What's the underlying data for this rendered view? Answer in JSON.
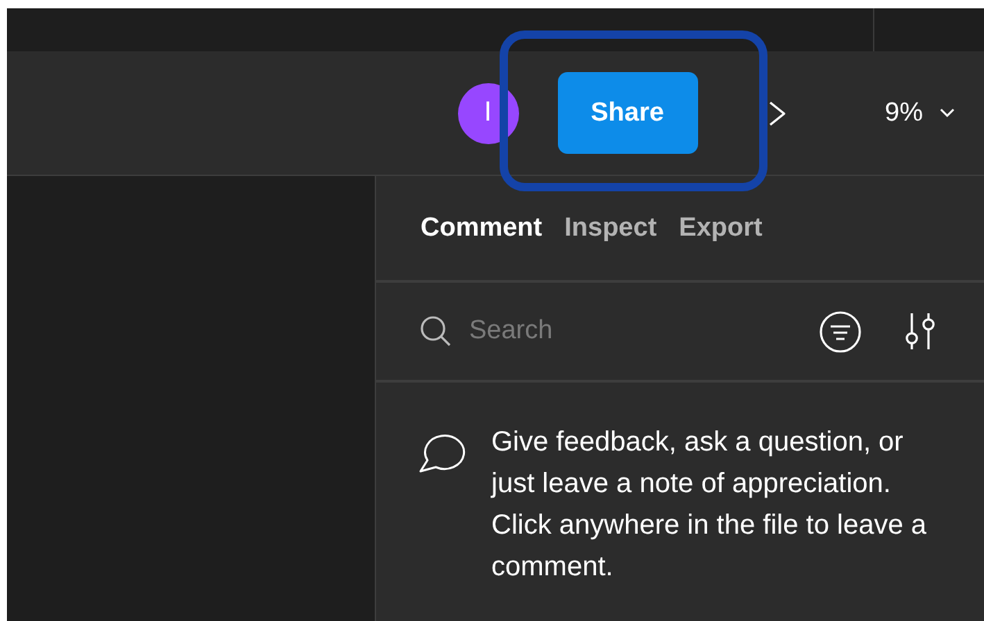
{
  "toolbar": {
    "avatar": {
      "initial": "I"
    },
    "share_button": {
      "label": "Share"
    },
    "zoom": {
      "value": "9%"
    }
  },
  "panel": {
    "tabs": [
      {
        "label": "Comment",
        "selected": true
      },
      {
        "label": "Inspect",
        "selected": false
      },
      {
        "label": "Export",
        "selected": false
      }
    ],
    "search": {
      "placeholder": "Search"
    },
    "empty_state": {
      "message": "Give feedback, ask a question, or just leave a note of appreciation. Click anywhere in the file to leave a comment."
    }
  }
}
